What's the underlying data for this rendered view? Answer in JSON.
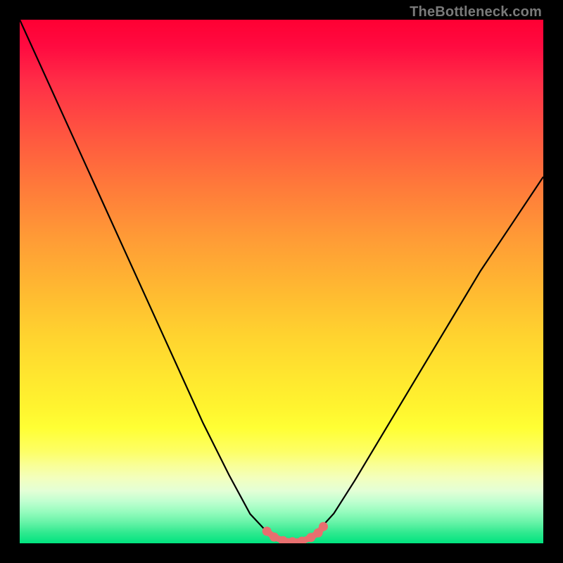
{
  "attribution": "TheBottleneck.com",
  "colors": {
    "curve_stroke": "#000000",
    "highlight": "#e86f6f",
    "background_top": "#ff0033",
    "background_bottom": "#00e37f",
    "frame": "#000000"
  },
  "chart_data": {
    "type": "line",
    "title": "",
    "xlabel": "",
    "ylabel": "",
    "xlim": [
      0,
      100
    ],
    "ylim": [
      0,
      100
    ],
    "grid": false,
    "legend": false,
    "series": [
      {
        "name": "bottleneck-curve",
        "x": [
          0,
          5,
          10,
          15,
          20,
          25,
          30,
          35,
          40,
          44,
          47,
          49,
          51,
          53,
          55,
          57,
          60,
          64,
          70,
          76,
          82,
          88,
          94,
          100
        ],
        "y": [
          100,
          89,
          78,
          67,
          56,
          45,
          34,
          23,
          13,
          5.6,
          2.4,
          0.9,
          0.3,
          0.3,
          0.9,
          2.4,
          5.7,
          12,
          22,
          32,
          42,
          52,
          61,
          70
        ]
      }
    ],
    "highlight_region": {
      "name": "optimal-range",
      "x_start": 47,
      "x_end": 58,
      "points": [
        {
          "x": 47.2,
          "y": 2.3
        },
        {
          "x": 48.6,
          "y": 1.2
        },
        {
          "x": 50.3,
          "y": 0.5
        },
        {
          "x": 52.1,
          "y": 0.3
        },
        {
          "x": 53.9,
          "y": 0.4
        },
        {
          "x": 55.6,
          "y": 1.1
        },
        {
          "x": 57.0,
          "y": 2.0
        },
        {
          "x": 58.0,
          "y": 3.2
        }
      ]
    }
  }
}
